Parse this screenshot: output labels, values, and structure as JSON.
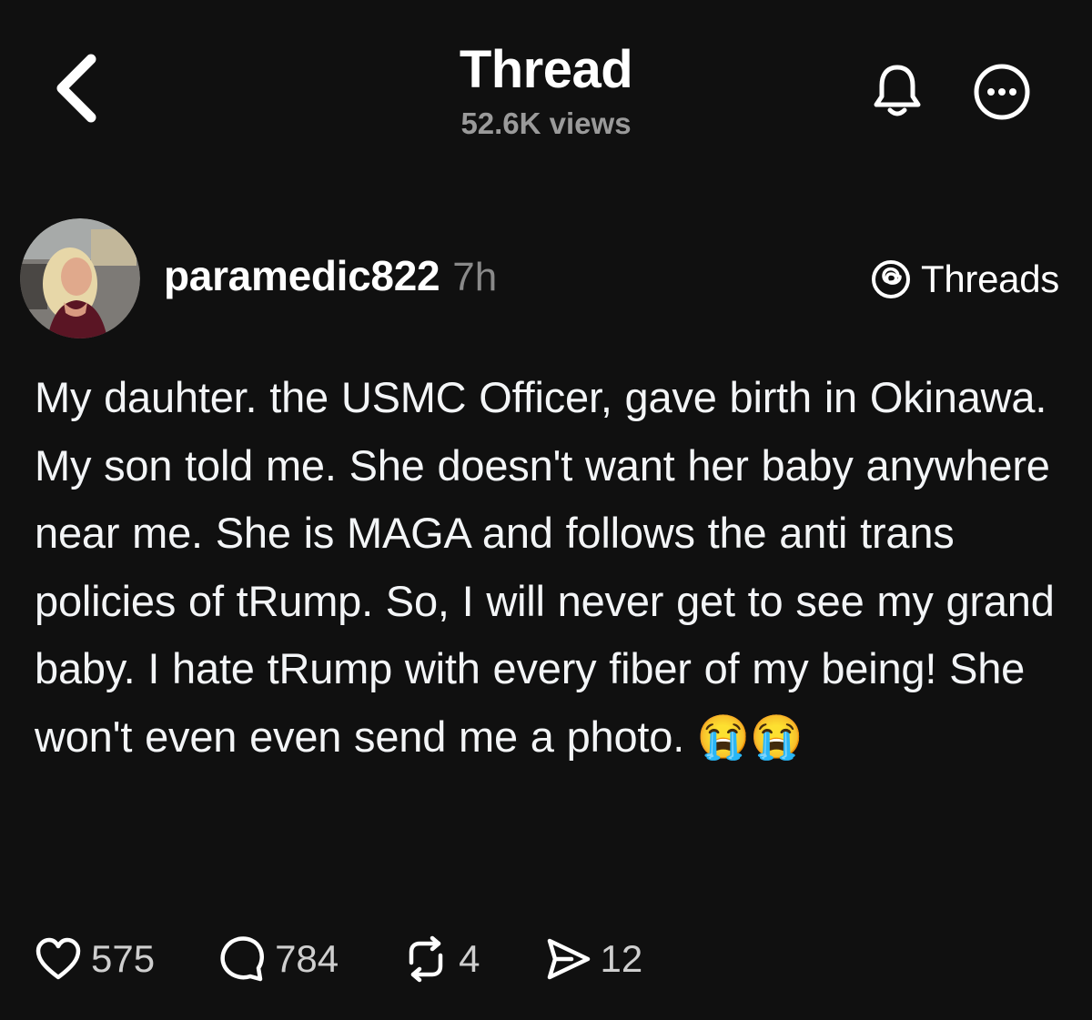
{
  "header": {
    "title": "Thread",
    "views": "52.6K views",
    "back_icon": "chevron-left-icon",
    "bell_icon": "bell-icon",
    "more_icon": "more-icon"
  },
  "post": {
    "username": "paramedic822",
    "timestamp": "7h",
    "platform_badge": "Threads",
    "text": "My dauhter. the USMC Officer, gave birth in Okinawa. My son told me. She doesn't want her baby anywhere near me. She is MAGA and follows the anti trans policies of tRump. So, I will never get to see my grand baby. I hate tRump with every fiber of my being! She won't even even send me a photo. 😭😭",
    "actions": {
      "likes": "575",
      "replies": "784",
      "reposts": "4",
      "shares": "12"
    }
  },
  "colors": {
    "background": "#101010",
    "text": "#f3f5f7",
    "muted": "#9a9a9a"
  }
}
